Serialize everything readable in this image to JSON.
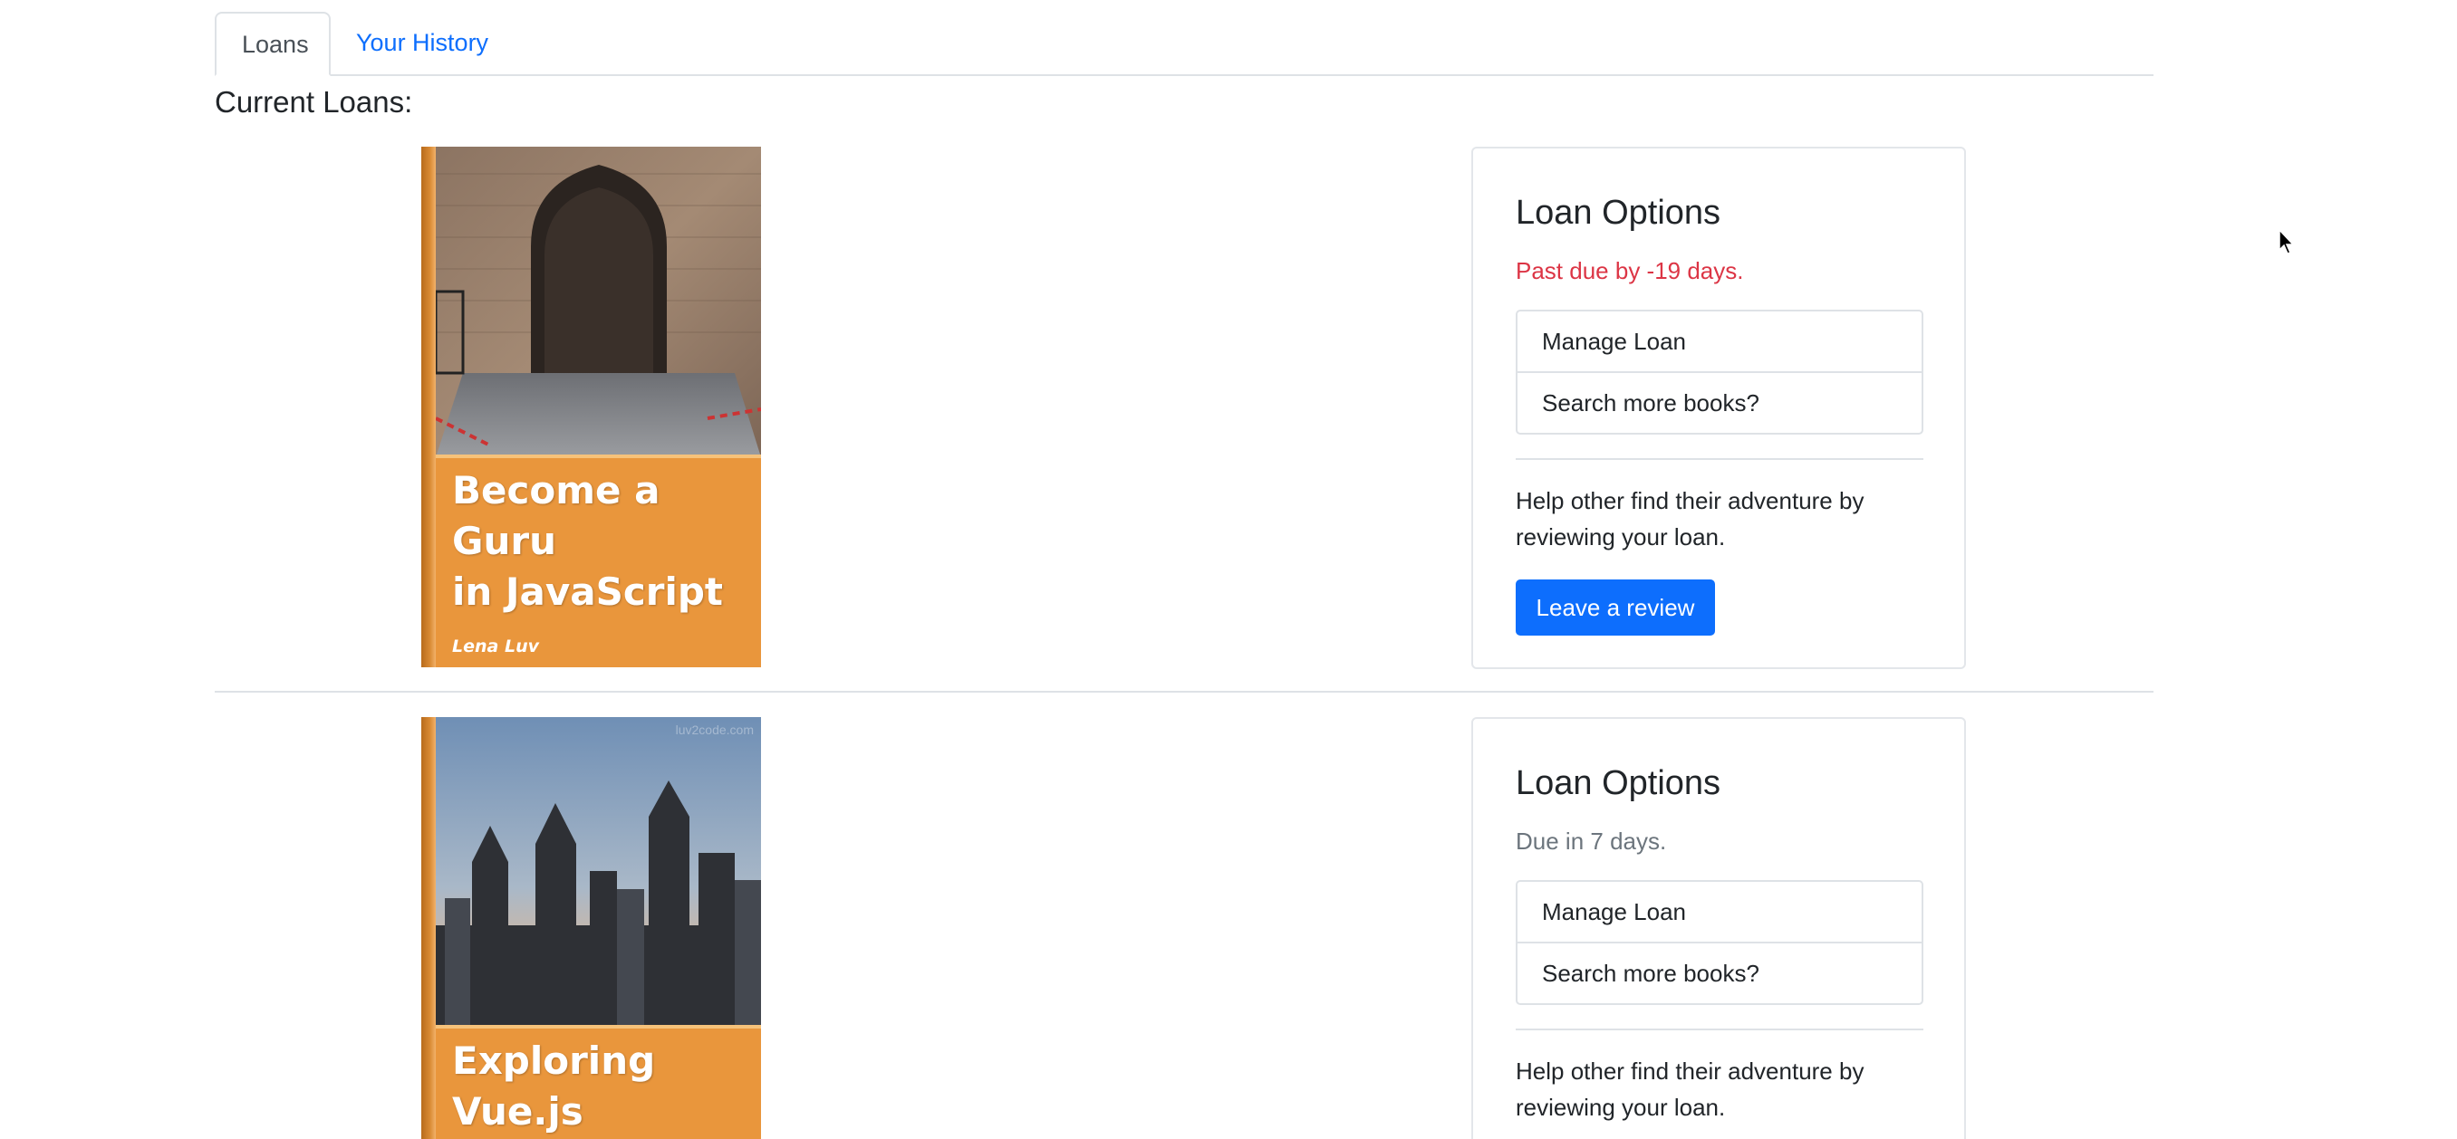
{
  "tabs": [
    {
      "label": "Loans",
      "active": true
    },
    {
      "label": "Your History",
      "active": false
    }
  ],
  "section_title": "Current Loans:",
  "loans": [
    {
      "cover_title_line1": "Become a Guru",
      "cover_title_line2": "in JavaScript",
      "cover_author": "Lena Luv",
      "card_title": "Loan Options",
      "due_text": "Past due by -19 days.",
      "due_color": "#dc3545",
      "actions": [
        "Manage Loan",
        "Search more books?"
      ],
      "help_text": "Help other find their adventure by reviewing your loan.",
      "review_button": "Leave a review"
    },
    {
      "cover_title_line1": "Exploring",
      "cover_title_line2": "Vue.js",
      "cover_watermark": "luv2code.com",
      "card_title": "Loan Options",
      "due_text": "Due in 7 days.",
      "due_color": "#6c757d",
      "actions": [
        "Manage Loan",
        "Search more books?"
      ],
      "help_text": "Help other find their adventure by reviewing your loan."
    }
  ],
  "colors": {
    "primary": "#0d6efd",
    "danger": "#dc3545",
    "muted": "#6c757d",
    "cover_orange": "#e9963c"
  }
}
